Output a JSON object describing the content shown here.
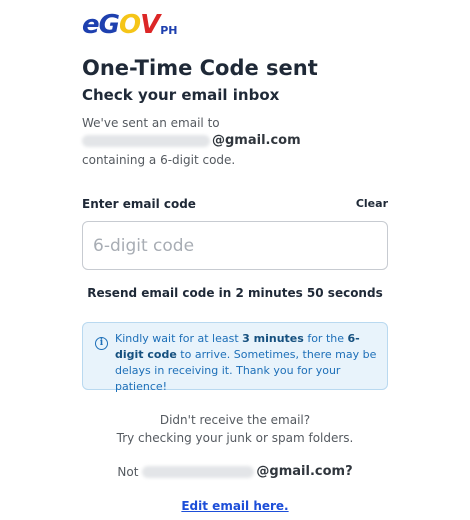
{
  "logo": {
    "e": "e",
    "g": "G",
    "o": "O",
    "v": "V",
    "ph": "PH"
  },
  "title": "One-Time Code sent",
  "subtitle": "Check your email inbox",
  "sent": {
    "line1": "We've sent an email to",
    "email_domain": "@gmail.com",
    "line3": "containing a 6-digit code."
  },
  "code": {
    "label": "Enter email code",
    "clear": "Clear",
    "placeholder": "6-digit code",
    "value": ""
  },
  "resend": "Resend email code in 2 minutes 50 seconds",
  "info": {
    "pre": "Kindly wait for at least ",
    "bold1": "3 minutes",
    "mid": " for the ",
    "bold2": "6-digit code",
    "post": " to arrive. Sometimes, there may be delays in receiving it. Thank you for your patience!"
  },
  "help": {
    "didnt": "Didn't receive the email?",
    "try": "Try checking your junk or spam folders."
  },
  "not_email": {
    "prefix": "Not",
    "domain": "@gmail.com?"
  },
  "edit_link": "Edit email here.",
  "colors": {
    "logo_blue": "#1e40af",
    "logo_yellow": "#f5c518",
    "logo_red": "#dc2626",
    "info_bg": "#e8f3fb",
    "info_text": "#1d6fb8",
    "link": "#1d4ed8"
  },
  "icons": {
    "info": "info-circle-icon"
  }
}
